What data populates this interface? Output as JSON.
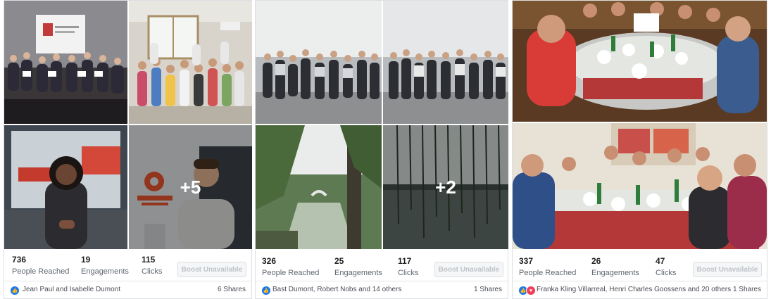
{
  "posts": [
    {
      "photos": [
        {
          "name": "conference-room-group-photo",
          "more": ""
        },
        {
          "name": "children-group-photo",
          "more": ""
        },
        {
          "name": "woman-at-office-photo",
          "more": ""
        },
        {
          "name": "enwise-office-photo",
          "more": "+5"
        }
      ],
      "stats": {
        "reached_value": "736",
        "reached_label": "People Reached",
        "engagements_value": "19",
        "engagements_label": "Engagements",
        "clicks_value": "115",
        "clicks_label": "Clicks"
      },
      "boost_label": "Boost Unavailable",
      "reaction_names": "Jean Paul and Isabelle Dumont",
      "shares": "6 Shares"
    },
    {
      "photos": [
        {
          "name": "lakeside-group-photo-1",
          "more": ""
        },
        {
          "name": "lakeside-group-photo-2",
          "more": ""
        },
        {
          "name": "willow-canal-bridge-photo",
          "more": ""
        },
        {
          "name": "willow-lake-photo",
          "more": "+2"
        }
      ],
      "stats": {
        "reached_value": "326",
        "reached_label": "People Reached",
        "engagements_value": "25",
        "engagements_label": "Engagements",
        "clicks_value": "117",
        "clicks_label": "Clicks"
      },
      "boost_label": "Boost Unavailable",
      "reaction_names": "Bast Dumont, Robert Nobs and 14 others",
      "shares": "1 Shares"
    },
    {
      "photos": [
        {
          "name": "dinner-table-photo-1",
          "more": ""
        },
        {
          "name": "dinner-table-photo-2",
          "more": ""
        }
      ],
      "stats": {
        "reached_value": "337",
        "reached_label": "People Reached",
        "engagements_value": "26",
        "engagements_label": "Engagements",
        "clicks_value": "47",
        "clicks_label": "Clicks"
      },
      "boost_label": "Boost Unavailable",
      "reaction_names": "Franka Kling Villarreal, Henri Charles Goossens and 20 others",
      "shares": "1 Shares"
    }
  ]
}
